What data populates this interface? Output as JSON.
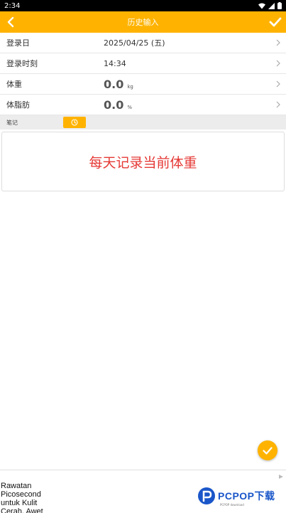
{
  "status_bar": {
    "time": "2:34"
  },
  "app_bar": {
    "title": "历史输入"
  },
  "form": {
    "rows": [
      {
        "label": "登录日",
        "value": "2025/04/25 (五)",
        "unit": ""
      },
      {
        "label": "登录时刻",
        "value": "14:34",
        "unit": ""
      },
      {
        "label": "体重",
        "value": "0.0",
        "unit": "kg"
      },
      {
        "label": "体脂肪",
        "value": "0.0",
        "unit": "%"
      }
    ]
  },
  "note": {
    "label": "笔记",
    "text": "每天记录当前体重"
  },
  "ad": {
    "lines": [
      "Rawatan",
      "Picosecond",
      "untuk Kulit",
      "Cerah, Awet"
    ]
  },
  "watermark": {
    "text": "PCPOP下载",
    "sub": "PCPOP download"
  },
  "colors": {
    "accent": "#FFB300",
    "promo_text": "#e53935",
    "watermark": "#1a56c9"
  }
}
